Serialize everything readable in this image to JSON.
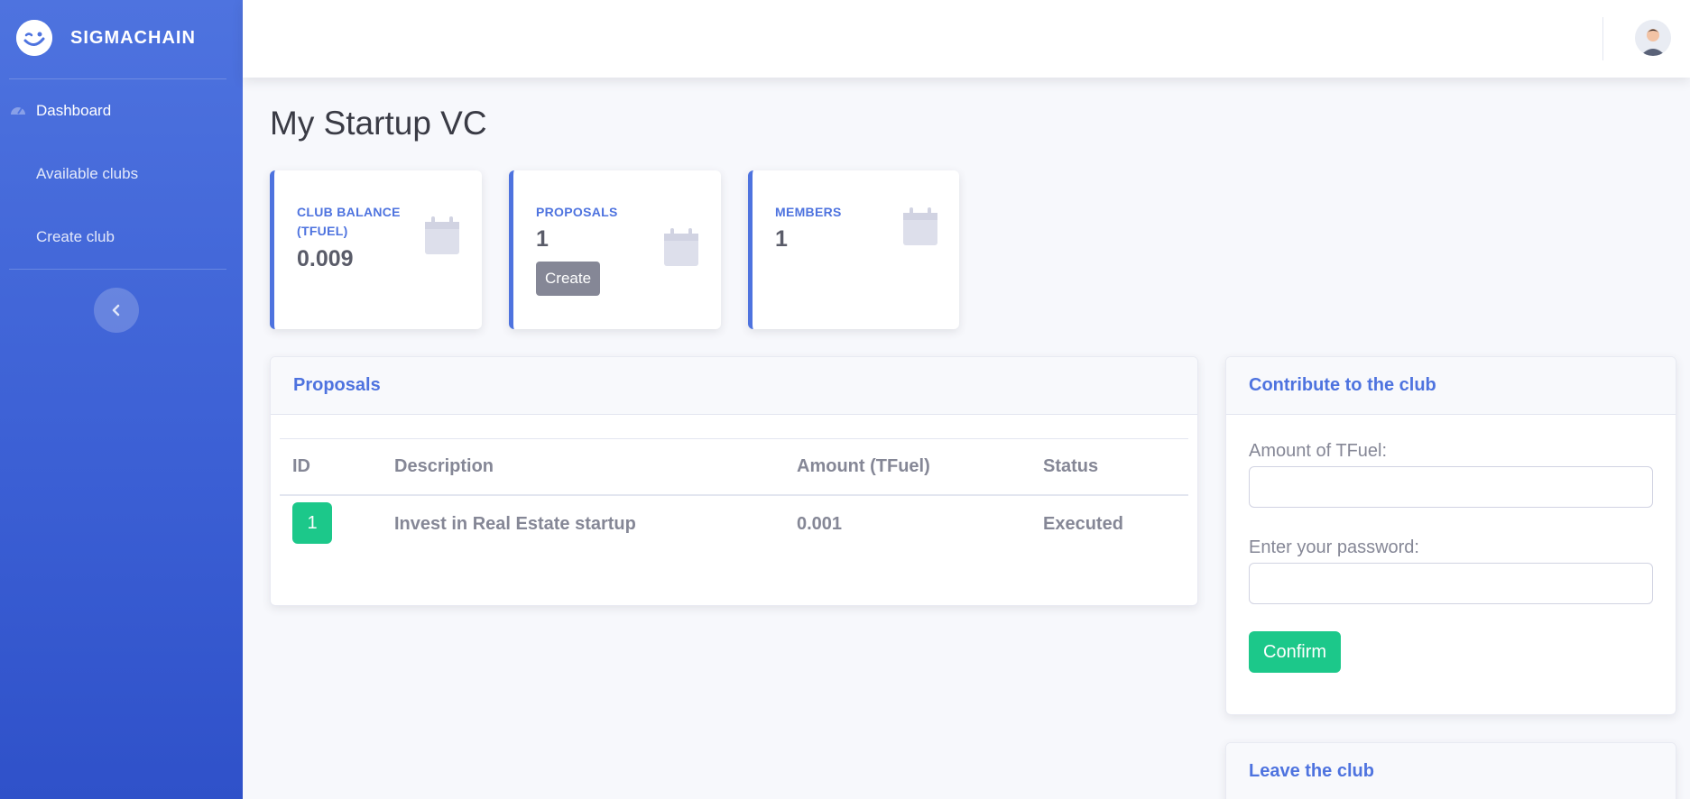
{
  "app": {
    "brand": "SIGMACHAIN",
    "accent_color": "#4e73df",
    "success_color": "#1cc88a"
  },
  "sidebar": {
    "items": [
      {
        "label": "Dashboard",
        "icon": "tachometer-icon"
      },
      {
        "label": "Available clubs"
      },
      {
        "label": "Create club"
      }
    ],
    "toggle_icon": "chevron-left-icon"
  },
  "page": {
    "title": "My Startup VC"
  },
  "stats": [
    {
      "label": "CLUB BALANCE (TFUEL)",
      "value": "0.009",
      "icon": "calendar-icon"
    },
    {
      "label": "PROPOSALS",
      "value": "1",
      "button": "Create",
      "icon": "calendar-icon"
    },
    {
      "label": "MEMBERS",
      "value": "1",
      "icon": "calendar-icon"
    }
  ],
  "proposals": {
    "title": "Proposals",
    "columns": [
      "ID",
      "Description",
      "Amount (TFuel)",
      "Status"
    ],
    "rows": [
      {
        "id": "1",
        "description": "Invest in Real Estate startup",
        "amount": "0.001",
        "status": "Executed"
      }
    ]
  },
  "contribute": {
    "title": "Contribute to the club",
    "amount_label": "Amount of TFuel:",
    "amount_value": "",
    "password_label": "Enter your password:",
    "password_value": "",
    "confirm_label": "Confirm"
  },
  "leave": {
    "title": "Leave the club"
  }
}
